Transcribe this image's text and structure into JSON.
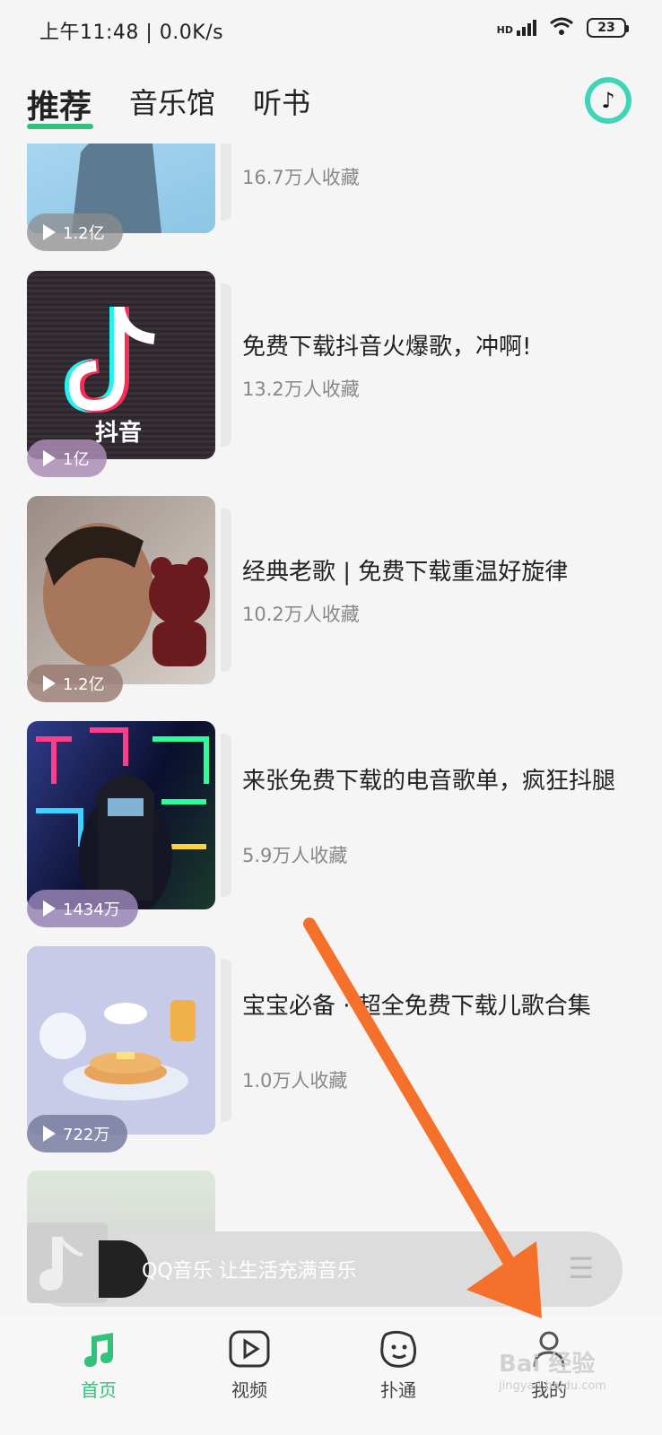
{
  "status_bar": {
    "time": "上午11:48 | 0.0K/s",
    "battery": "23",
    "signal": "HD"
  },
  "header": {
    "tabs": [
      {
        "label": "推荐"
      },
      {
        "label": "音乐馆"
      },
      {
        "label": "听书"
      }
    ]
  },
  "playlists": [
    {
      "title": "",
      "subtitle": "16.7万人收藏",
      "plays": "1.2亿"
    },
    {
      "title": "免费下载抖音火爆歌，冲啊!",
      "subtitle": "13.2万人收藏",
      "plays": "1亿",
      "thumb_text": "抖音"
    },
    {
      "title": "经典老歌 | 免费下载重温好旋律",
      "subtitle": "10.2万人收藏",
      "plays": "1.2亿"
    },
    {
      "title": "来张免费下载的电音歌单，疯狂抖腿",
      "subtitle": "5.9万人收藏",
      "plays": "1434万"
    },
    {
      "title": "宝宝必备 · 超全免费下载儿歌合集",
      "subtitle": "1.0万人收藏",
      "plays": "722万"
    }
  ],
  "mini_player": {
    "text": "QQ音乐 让生活充满音乐"
  },
  "bottom_nav": [
    {
      "label": "首页",
      "icon": "music-note-icon"
    },
    {
      "label": "视频",
      "icon": "video-play-icon"
    },
    {
      "label": "扑通",
      "icon": "face-icon"
    },
    {
      "label": "我的",
      "icon": "person-icon"
    }
  ],
  "watermark": {
    "text": "Bai 经验",
    "sub": "jingyan.baidu.com"
  },
  "colors": {
    "accent": "#31c27c",
    "arrow": "#f5702a"
  }
}
